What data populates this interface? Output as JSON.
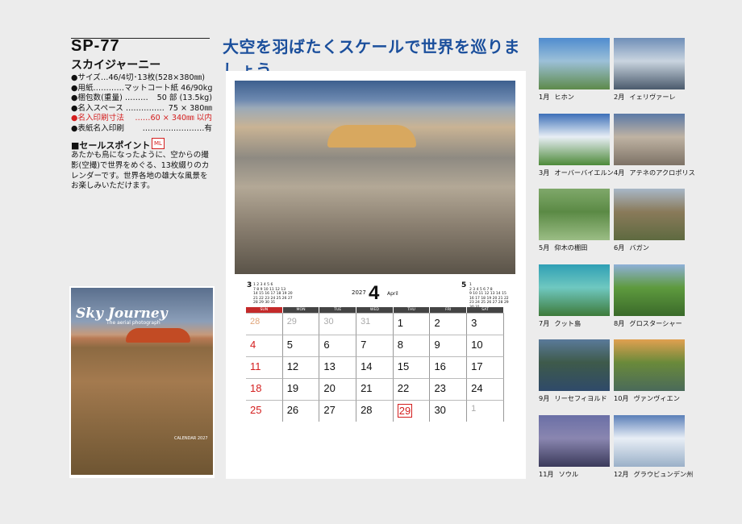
{
  "product": {
    "code": "SP-77",
    "name": "スカイジャーニー",
    "specs": [
      {
        "label": "●サイズ…46/4切･13枚(528×380㎜)",
        "value": "",
        "red": false
      },
      {
        "label": "●用紙…………",
        "value": "マットコート紙 46/90kg",
        "red": false
      },
      {
        "label": "●梱包数(重量) ………",
        "value": "50 部 (13.5kg)",
        "red": false
      },
      {
        "label": "●名入スペース ……………",
        "value": "75 × 380㎜",
        "red": false
      },
      {
        "label": "●名入印刷寸法",
        "value": "……60 × 340㎜ 以内",
        "red": true
      },
      {
        "label": "●表紙名入印刷",
        "value": "……………………有",
        "red": false
      }
    ],
    "sales_heading": "■セールスポイント",
    "sales_badge": "ML",
    "sales_text": "あたかも鳥になったように、空からの撮影(空撮)で世界をめぐる、13枚綴りのカレンダーです。世界各地の雄大な風景をお楽しみいただけます。"
  },
  "cover": {
    "title": "Sky Journey",
    "subtitle": "The aerial photograph",
    "calendar_label": "CALENDAR 2027"
  },
  "headline": "大空を羽ばたくスケールで世界を巡りましょう",
  "calendar": {
    "year": "2027",
    "month_number": "4",
    "month_name": "April",
    "prev_month_num": "3",
    "next_month_num": "5",
    "weekdays": [
      "SUN",
      "MON",
      "TUE",
      "WED",
      "THU",
      "FRI",
      "SAT"
    ],
    "weeks": [
      [
        {
          "d": "28",
          "t": "dimsun"
        },
        {
          "d": "29",
          "t": "dim"
        },
        {
          "d": "30",
          "t": "dim"
        },
        {
          "d": "31",
          "t": "dim"
        },
        {
          "d": "1",
          "t": ""
        },
        {
          "d": "2",
          "t": ""
        },
        {
          "d": "3",
          "t": ""
        }
      ],
      [
        {
          "d": "4",
          "t": "sun"
        },
        {
          "d": "5",
          "t": ""
        },
        {
          "d": "6",
          "t": ""
        },
        {
          "d": "7",
          "t": ""
        },
        {
          "d": "8",
          "t": ""
        },
        {
          "d": "9",
          "t": ""
        },
        {
          "d": "10",
          "t": ""
        }
      ],
      [
        {
          "d": "11",
          "t": "sun"
        },
        {
          "d": "12",
          "t": ""
        },
        {
          "d": "13",
          "t": ""
        },
        {
          "d": "14",
          "t": ""
        },
        {
          "d": "15",
          "t": ""
        },
        {
          "d": "16",
          "t": ""
        },
        {
          "d": "17",
          "t": ""
        }
      ],
      [
        {
          "d": "18",
          "t": "sun"
        },
        {
          "d": "19",
          "t": ""
        },
        {
          "d": "20",
          "t": ""
        },
        {
          "d": "21",
          "t": ""
        },
        {
          "d": "22",
          "t": ""
        },
        {
          "d": "23",
          "t": ""
        },
        {
          "d": "24",
          "t": ""
        }
      ],
      [
        {
          "d": "25",
          "t": "sun"
        },
        {
          "d": "26",
          "t": ""
        },
        {
          "d": "27",
          "t": ""
        },
        {
          "d": "28",
          "t": ""
        },
        {
          "d": "29",
          "t": "hol"
        },
        {
          "d": "30",
          "t": ""
        },
        {
          "d": "1",
          "t": "dim"
        }
      ]
    ],
    "mini_prev": [
      "1 2 3 4 5 6",
      "7 8 9 10 11 12 13",
      "14 15 16 17 18 19 20",
      "21 22 23 24 25 26 27",
      "28 29 30 31"
    ],
    "mini_next": [
      "1",
      "2 3 4 5 6 7 8",
      "9 10 11 12 13 14 15",
      "16 17 18 19 20 21 22",
      "23 24 25 26 27 28 29",
      "30 31"
    ]
  },
  "months": [
    {
      "m": "1月",
      "place": "ヒホン",
      "colors": [
        "#4f8ccf",
        "#9cc0d8",
        "#5d8a4a"
      ]
    },
    {
      "m": "2月",
      "place": "イェリヴァーレ",
      "colors": [
        "#6f8fb8",
        "#c9d4df",
        "#4a5a6c"
      ]
    },
    {
      "m": "3月",
      "place": "オーバーバイエルン",
      "colors": [
        "#3c6fb8",
        "#e8eef5",
        "#4e8a3a"
      ]
    },
    {
      "m": "4月",
      "place": "アテネのアクロポリス",
      "colors": [
        "#5b79a6",
        "#bfb3a3",
        "#7d7266"
      ]
    },
    {
      "m": "5月",
      "place": "仰木の棚田",
      "colors": [
        "#7fa86a",
        "#5b8a45",
        "#9bbd85"
      ]
    },
    {
      "m": "6月",
      "place": "バガン",
      "colors": [
        "#a8b7c7",
        "#8a7a5a",
        "#5e6a40"
      ]
    },
    {
      "m": "7月",
      "place": "クット島",
      "colors": [
        "#2f9fb5",
        "#6fc8c0",
        "#3e7a3a"
      ]
    },
    {
      "m": "8月",
      "place": "グロスターシャー",
      "colors": [
        "#8fb0d8",
        "#5e9a3e",
        "#3a6a2a"
      ]
    },
    {
      "m": "9月",
      "place": "リーセフィヨルド",
      "colors": [
        "#5a7a9a",
        "#3e5a4a",
        "#2f4a6a"
      ]
    },
    {
      "m": "10月",
      "place": "ヴァンヴィエン",
      "colors": [
        "#e0a050",
        "#6a8a3a",
        "#4a6a5a"
      ]
    },
    {
      "m": "11月",
      "place": "ソウル",
      "colors": [
        "#6a6fa6",
        "#8a86b0",
        "#3a3a5a"
      ]
    },
    {
      "m": "12月",
      "place": "グラウビュンデン州",
      "colors": [
        "#5a7fb8",
        "#e8eef6",
        "#9ab0c8"
      ]
    }
  ]
}
